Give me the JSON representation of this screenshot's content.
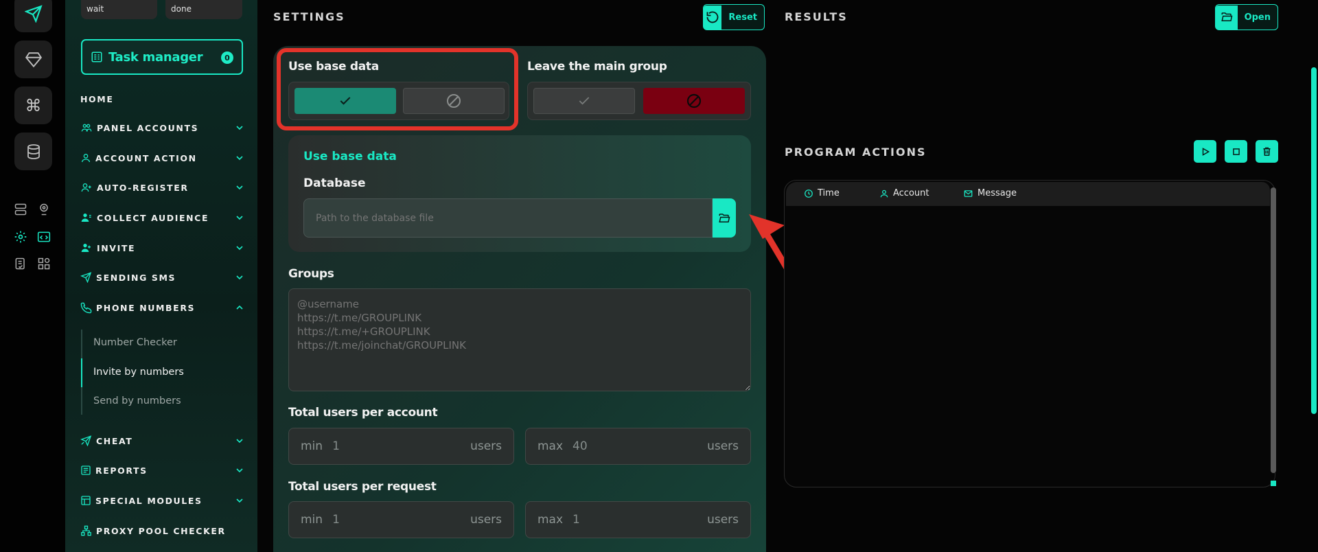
{
  "sidebar": {
    "status_boxes": [
      "wait",
      "done"
    ],
    "task_manager": {
      "label": "Task manager",
      "count": "0"
    },
    "nav": [
      {
        "label": "HOME"
      },
      {
        "label": "PANEL ACCOUNTS"
      },
      {
        "label": "ACCOUNT ACTION"
      },
      {
        "label": "AUTO-REGISTER"
      },
      {
        "label": "COLLECT AUDIENCE"
      },
      {
        "label": "INVITE"
      },
      {
        "label": "SENDING SMS"
      },
      {
        "label": "PHONE NUMBERS"
      },
      {
        "label": "CHEAT"
      },
      {
        "label": "REPORTS"
      },
      {
        "label": "SPECIAL MODULES"
      },
      {
        "label": "PROXY POOL CHECKER"
      }
    ],
    "sub_items": [
      "Number Checker",
      "Invite by numbers",
      "Send by numbers"
    ]
  },
  "settings": {
    "title": "SETTINGS",
    "reset_label": "Reset",
    "use_base_data_label": "Use base data",
    "leave_group_label": "Leave the main group",
    "card_title": "Use base data",
    "database_label": "Database",
    "database_placeholder": "Path to the database file",
    "groups_label": "Groups",
    "groups_placeholder": "@username\nhttps://t.me/GROUPLINK\nhttps://t.me/+GROUPLINK\nhttps://t.me/joinchat/GROUPLINK",
    "per_account_label": "Total users per account",
    "per_request_label": "Total users per request",
    "per_account": {
      "min_prefix": "min",
      "min_value": "1",
      "max_prefix": "max",
      "max_value": "40",
      "unit": "users"
    },
    "per_request": {
      "min_prefix": "min",
      "min_value": "1",
      "max_prefix": "max",
      "max_value": "1",
      "unit": "users"
    }
  },
  "results": {
    "title": "RESULTS",
    "open_label": "Open"
  },
  "actions": {
    "title": "PROGRAM ACTIONS",
    "columns": [
      "Time",
      "Account",
      "Message"
    ]
  },
  "colors": {
    "accent": "#19e8c4",
    "danger": "#7a0011",
    "highlight": "#e2332a"
  }
}
